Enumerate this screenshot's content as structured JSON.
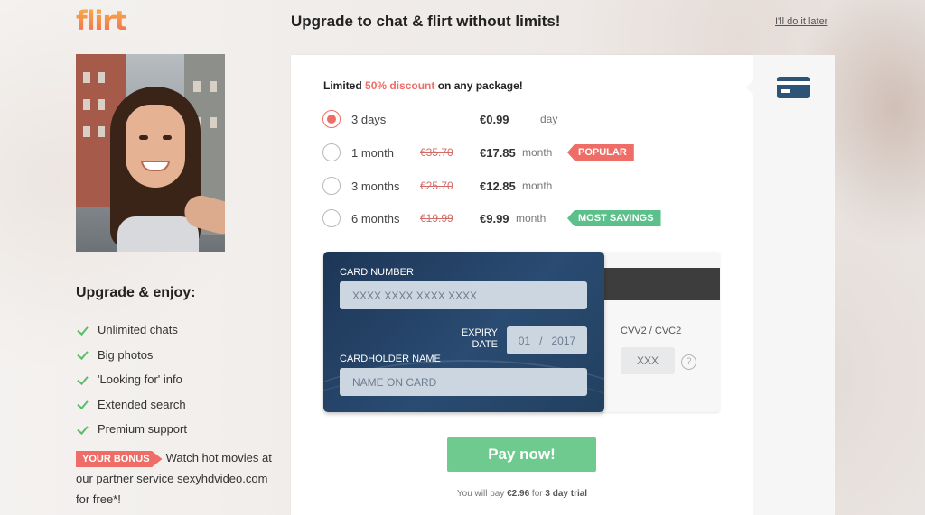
{
  "header": {
    "logo": "flirt",
    "title": "Upgrade to chat & flirt without limits!",
    "skip_link": "I'll do it later"
  },
  "sidebar": {
    "enjoy_title": "Upgrade & enjoy:",
    "features": [
      "Unlimited chats",
      "Big photos",
      "'Looking for' info",
      "Extended search",
      "Premium support"
    ],
    "bonus_tag": "YOUR BONUS",
    "bonus_text": "Watch hot movies at our partner service sexyhdvideo.com for free*!"
  },
  "offer": {
    "prefix": "Limited ",
    "highlight": "50% discount",
    "suffix": " on any package!"
  },
  "plans": [
    {
      "name": "3 days",
      "old_price": "",
      "price": "€0.99",
      "unit": "day",
      "tag": "",
      "selected": true
    },
    {
      "name": "1 month",
      "old_price": "€35.70",
      "price": "€17.85",
      "unit": "month",
      "tag": "POPULAR",
      "selected": false
    },
    {
      "name": "3 months",
      "old_price": "€25.70",
      "price": "€12.85",
      "unit": "month",
      "tag": "",
      "selected": false
    },
    {
      "name": "6 months",
      "old_price": "€19.99",
      "price": "€9.99",
      "unit": "month",
      "tag": "MOST SAVINGS",
      "selected": false
    }
  ],
  "card": {
    "number_label": "CARD NUMBER",
    "number_placeholder": "XXXX XXXX XXXX XXXX",
    "expiry_label": "EXPIRY DATE",
    "expiry_month": "01",
    "expiry_sep": "/",
    "expiry_year": "2017",
    "holder_label": "CARDHOLDER NAME",
    "holder_placeholder": "NAME ON CARD",
    "cvv_label": "CVV2 / CVC2",
    "cvv_placeholder": "XXX",
    "help": "?"
  },
  "payment": {
    "button": "Pay now!",
    "note_prefix": "You will pay ",
    "note_amount": "€2.96",
    "note_middle": " for ",
    "note_trial": "3 day trial"
  },
  "colors": {
    "accent_red": "#ee6d66",
    "accent_green": "#5cc08a",
    "pay_green": "#6fca8f",
    "card_navy": "#1d3656"
  },
  "icons": {
    "card_tab": "credit-card-icon",
    "feature": "check-icon"
  }
}
